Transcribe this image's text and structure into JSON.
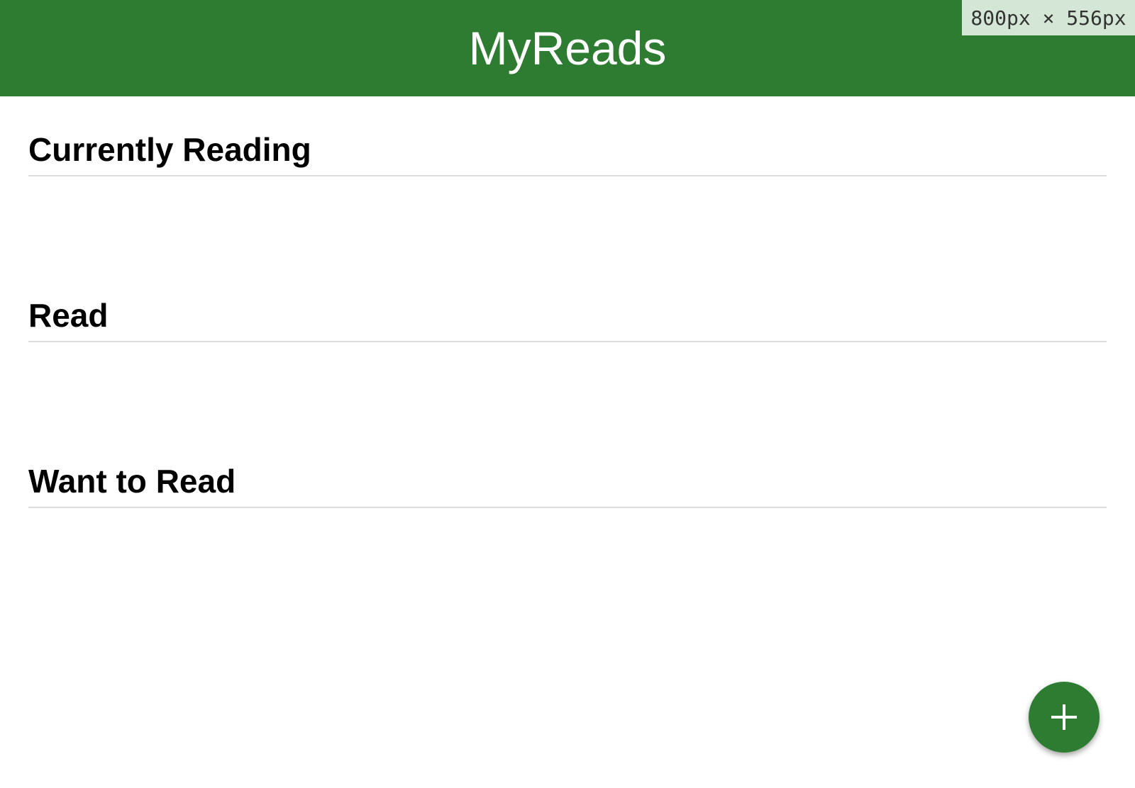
{
  "header": {
    "title": "MyReads",
    "color": "#2e7c31"
  },
  "viewport_badge": {
    "text": "800px × 556px"
  },
  "shelves": [
    {
      "title": "Currently Reading",
      "books": []
    },
    {
      "title": "Read",
      "books": []
    },
    {
      "title": "Want to Read",
      "books": []
    }
  ],
  "fab": {
    "icon": "plus-icon",
    "color": "#2e7c31"
  }
}
